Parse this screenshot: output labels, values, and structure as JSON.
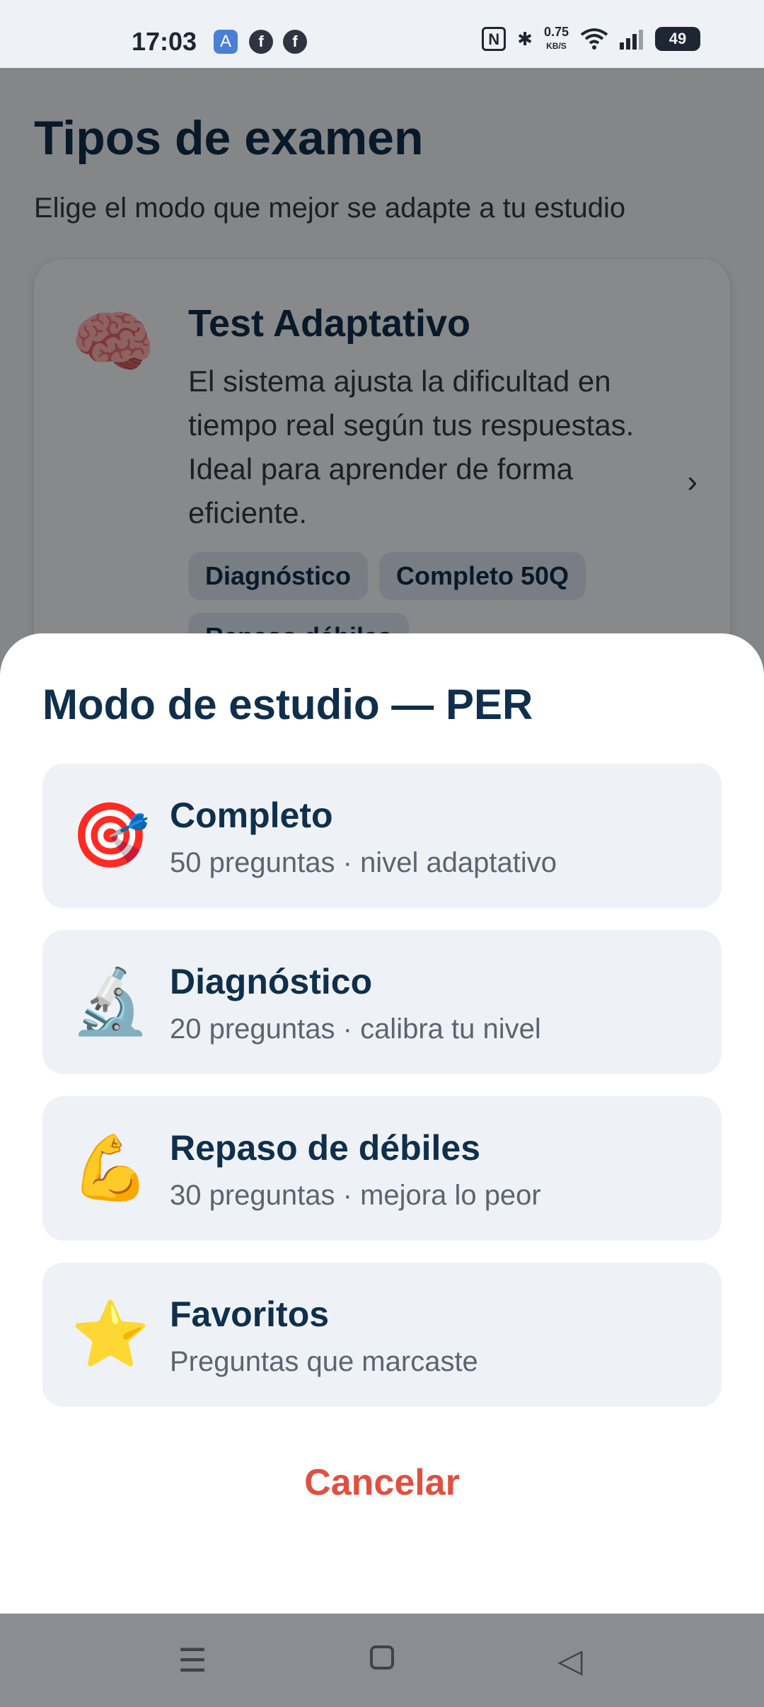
{
  "status_bar": {
    "time": "17:03",
    "speed_value": "0.75",
    "speed_unit": "KB/S",
    "battery": "49",
    "icons": [
      "app-icon",
      "facebook-icon",
      "facebook-icon",
      "nfc-icon",
      "bluetooth-icon",
      "wifi-icon",
      "signal-icon",
      "battery-icon"
    ]
  },
  "page": {
    "title": "Tipos de examen",
    "subtitle": "Elige el modo que mejor se adapte a tu estudio",
    "card": {
      "emoji": "🧠",
      "title": "Test Adaptativo",
      "description": "El sistema ajusta la dificultad en tiempo real según tus respuestas. Ideal para aprender de forma eficiente.",
      "chevron": "›",
      "tags": [
        "Diagnóstico",
        "Completo 50Q",
        "Repaso débiles"
      ]
    }
  },
  "sheet": {
    "title": "Modo de estudio — PER",
    "options": [
      {
        "emoji": "🎯",
        "title": "Completo",
        "subtitle": "50 preguntas · nivel adaptativo"
      },
      {
        "emoji": "🔬",
        "title": "Diagnóstico",
        "subtitle": "20 preguntas · calibra tu nivel"
      },
      {
        "emoji": "💪",
        "title": "Repaso de débiles",
        "subtitle": "30 preguntas · mejora lo peor"
      },
      {
        "emoji": "⭐",
        "title": "Favoritos",
        "subtitle": "Preguntas que marcaste"
      }
    ],
    "cancel_label": "Cancelar"
  },
  "nav_bar": {
    "menu_glyph": "☰",
    "back_glyph": "◁"
  },
  "colors": {
    "primary_text": "#0f2f4c",
    "cancel": "#e05040",
    "option_bg": "#eef2f7"
  }
}
